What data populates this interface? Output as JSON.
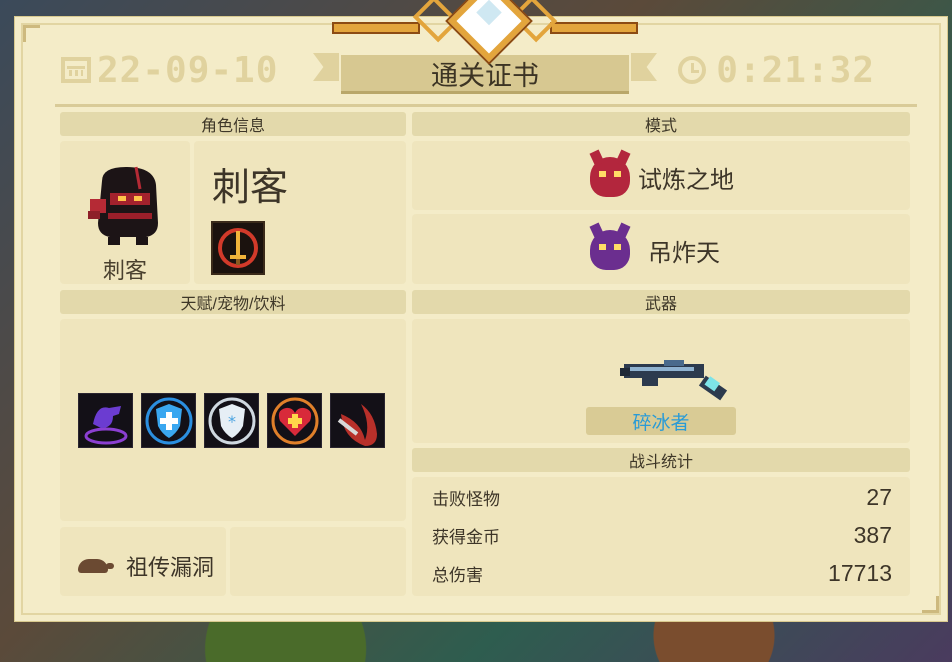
{
  "header": {
    "date": "22-09-10",
    "time": "0:21:32",
    "title": "通关证书"
  },
  "sections": {
    "character": "角色信息",
    "mode": "模式",
    "talents": "天赋/宠物/饮料",
    "weapon": "武器",
    "battle": "战斗统计"
  },
  "character": {
    "name_large": "刺客",
    "name_small": "刺客",
    "skill_icon": "sword-circle-icon"
  },
  "mode": [
    {
      "label": "试炼之地",
      "icon": "red-demon-icon",
      "color": "#b3263d"
    },
    {
      "label": "吊炸天",
      "icon": "purple-demon-icon",
      "color": "#6b2e8f"
    }
  ],
  "talents": [
    {
      "icon": "purple-hand-icon"
    },
    {
      "icon": "blue-shield-icon"
    },
    {
      "icon": "white-shield-icon"
    },
    {
      "icon": "heart-plus-icon"
    },
    {
      "icon": "red-claw-icon"
    }
  ],
  "pet": {
    "label": "祖传漏洞",
    "icon": "turtle-icon"
  },
  "weapon": {
    "name": "碎冰者",
    "icon": "ice-gun-icon",
    "name_color": "#2a9bd6"
  },
  "stats": [
    {
      "label": "击败怪物",
      "value": "27"
    },
    {
      "label": "获得金币",
      "value": "387"
    },
    {
      "label": "总伤害",
      "value": "17713"
    }
  ]
}
